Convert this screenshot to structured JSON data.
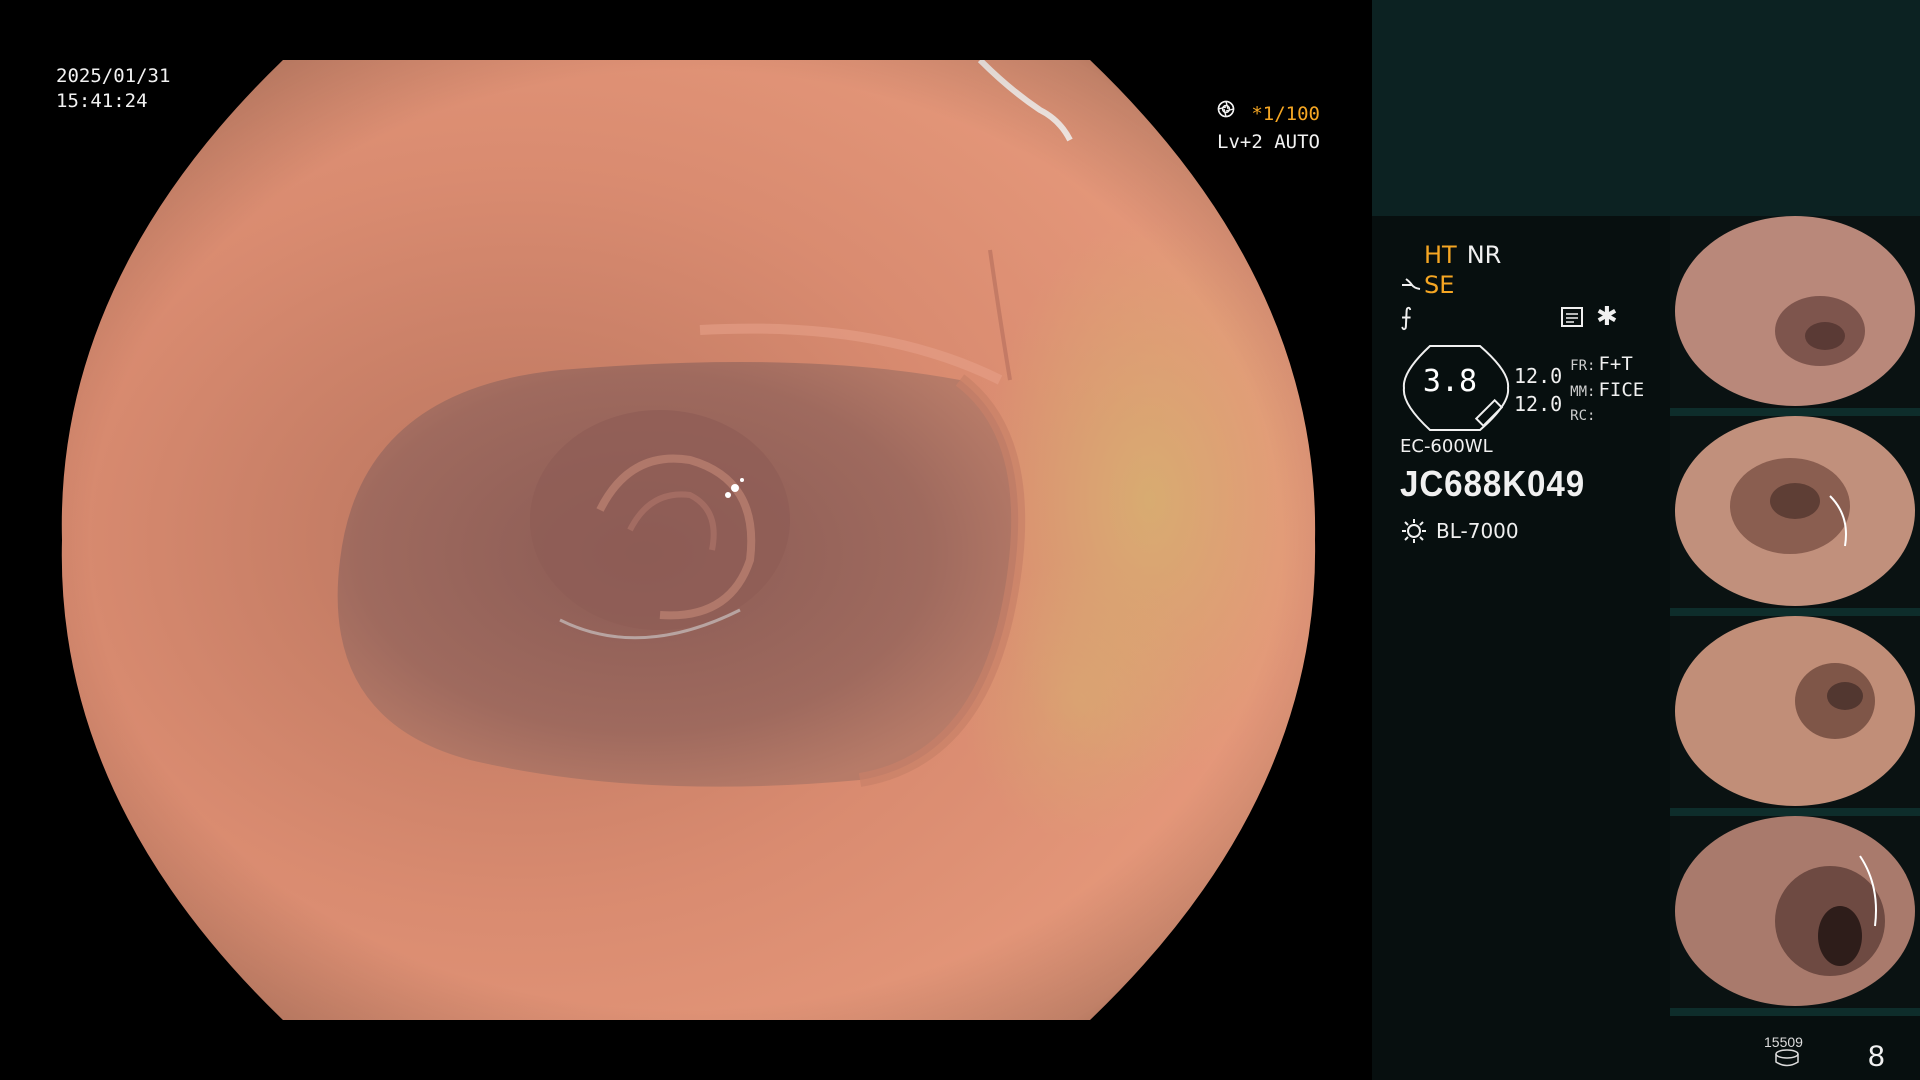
{
  "screen": {
    "date": "2025/01/31",
    "time": "15:41:24"
  },
  "overlay": {
    "shutter": "*1/100",
    "level_auto": "Lv+2 AUTO"
  },
  "panel": {
    "flags": {
      "ht": "HT",
      "nr": "NR",
      "se": "SE"
    },
    "gauge_value": "3.8",
    "levels": [
      "12.0",
      "12.0"
    ],
    "params": [
      {
        "key": "FR:",
        "value": "F+T"
      },
      {
        "key": "MM:",
        "value": "FICE"
      },
      {
        "key": "RC:",
        "value": ""
      }
    ],
    "scope_model": "EC-600WL",
    "serial": "JC688K049",
    "light_source": "BL-7000",
    "image_counter": "15509",
    "capture_count": "8"
  },
  "icons": {
    "aperture": "aperture-icon",
    "iris": "iris-icon",
    "scope_symbol": "scope-symbol-icon",
    "pen": "freeze-pen-icon",
    "doc": "memo-icon",
    "sun": "light-source-icon",
    "disk": "storage-disk-icon"
  },
  "colors": {
    "accent_orange": "#f5a623",
    "panel_top": "#0c2222",
    "panel_bg": "#070f0f",
    "tissue": "#d9886d"
  }
}
